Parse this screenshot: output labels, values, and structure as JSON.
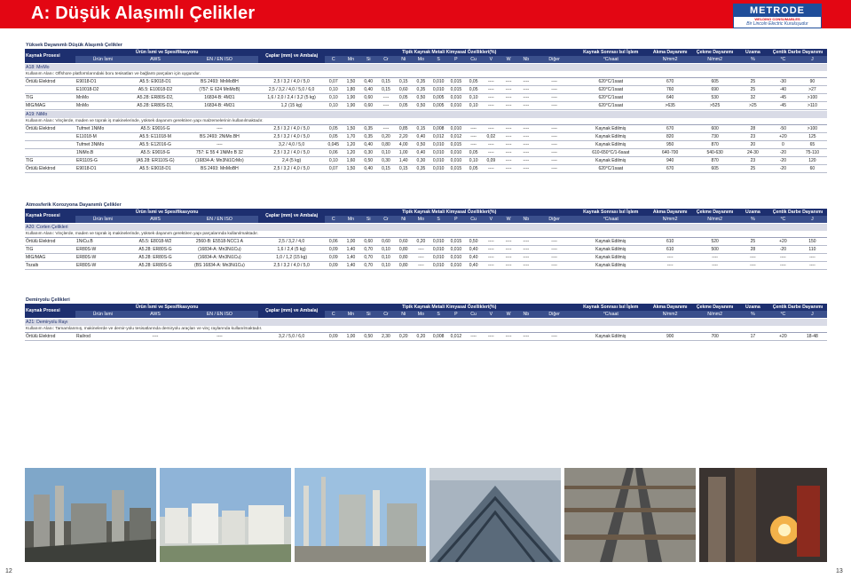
{
  "header": {
    "title": "A: Düşük Alaşımlı Çelikler",
    "logo_word": "METRODE",
    "logo_sub": "WELDING CONSUMABLES",
    "logo_tag": "Bir Lincoln Electric Kuruluşudur"
  },
  "colheads": {
    "process": "Kaynak Prosesi",
    "product_group": "Ürün İsmi  ve Spesifikasyonu",
    "product_name": "Ürün İsmi",
    "aws": "AWS",
    "en_iso": "EN / EN ISO",
    "diam": "Çaplar (mm) ve Ambalaj",
    "chem": "Tipik Kaynak Metali Kimyasal  Özellikleri(%)",
    "elements": [
      "C",
      "Mn",
      "Si",
      "Cr",
      "Ni",
      "Mo",
      "S",
      "P",
      "Cu",
      "V",
      "W",
      "Nb",
      "Diğer"
    ],
    "pwht": "Kaynak Sonrası Isıl İşlem",
    "pwht_unit": "°C/saat",
    "ys": "Akma Dayanımı",
    "ys_unit": "N/mm2",
    "ts": "Çekme Dayanımı",
    "ts_unit": "N/mm2",
    "el": "Uzama",
    "el_unit": "%",
    "imp": "Çentik Darbe Dayanımı",
    "imp_t_unit": "°C",
    "imp_j_unit": "J"
  },
  "sections": [
    {
      "title": "Yüksek Dayanımlı Düşük Alaşımlı Çelikler",
      "groups": [
        {
          "grade": "A18: MnMo",
          "usage": "Kullanım Alanı: Offshore platformlarındaki boru tesisatları ve bağlantı parçaları için uygundur.",
          "rows": [
            [
              "Örtülü Elektrod",
              "E9018-D1",
              "A5.5: E9018-D1",
              "BS 2493: MnMoBH",
              "2,5 / 3,2 / 4,0 / 5,0",
              "0,07",
              "1,50",
              "0,40",
              "0,15",
              "0,15",
              "0,35",
              "0,010",
              "0,015",
              "0,05",
              "----",
              "----",
              "----",
              "----",
              "620°C/1saat",
              "670",
              "605",
              "25",
              "-30",
              "90"
            ],
            [
              "",
              "E10018-D2",
              "A5.5: E10018-D2",
              "(757: E 624 MnMoB)",
              "2,5 / 3,2 / 4,0 / 5,0 / 6,0",
              "0,10",
              "1,80",
              "0,40",
              "0,15",
              "0,60",
              "0,35",
              "0,010",
              "0,015",
              "0,05",
              "----",
              "----",
              "----",
              "----",
              "620°C/1saat",
              "760",
              "690",
              "25",
              "-40",
              ">27"
            ],
            [
              "TIG",
              "MnMo",
              "A5.28: ER80S-D2,",
              "16834-B: 4M31",
              "1,6 / 2,0 / 2,4 / 3,2  (5 kg)",
              "0,10",
              "1,90",
              "0,60",
              "----",
              "0,05",
              "0,50",
              "0,005",
              "0,010",
              "0,10",
              "----",
              "----",
              "----",
              "----",
              "620°C/1saat",
              "640",
              "530",
              "32",
              "-45",
              ">100"
            ],
            [
              "MIG/MAG",
              "MnMo",
              "A5.28: ER80S-D2,",
              "16834-B: 4M31",
              "1,2 (15 kg)",
              "0,10",
              "1,90",
              "0,60",
              "----",
              "0,05",
              "0,50",
              "0,005",
              "0,010",
              "0,10",
              "----",
              "----",
              "----",
              "----",
              "620°C/1saat",
              ">635",
              ">525",
              ">25",
              "-45",
              ">110"
            ]
          ]
        },
        {
          "grade": "A19: NiMo",
          "usage": "Kullanım Alanı: Vinçlerde,  maden ve toprak iş makinelerinde, yüksek dayanım gerektiren yapı malzemelerinin kullanılmaktadır.",
          "rows": [
            [
              "Örtülü Elektrod",
              "Tufmet 1NiMo",
              "A5.5: E9016-G",
              "----",
              "2,5 / 3,2 / 4,0 / 5,0",
              "0,05",
              "1,50",
              "0,35",
              "----",
              "0,85",
              "0,15",
              "0,008",
              "0,010",
              "----",
              "----",
              "----",
              "----",
              "----",
              "Kaynak Edilmiş",
              "670",
              "600",
              "28",
              "-50",
              ">100"
            ],
            [
              "",
              "E11018-M",
              "A5.5: E11018-M",
              "BS 2493: 2NiMo.BH",
              "2,5 / 3,2 / 4,0 / 5,0",
              "0,05",
              "1,70",
              "0,35",
              "0,20",
              "2,20",
              "0,40",
              "0,012",
              "0,012",
              "----",
              "0,02",
              "----",
              "----",
              "----",
              "Kaynak Edilmiş",
              "820",
              "730",
              "23",
              "+20",
              "125"
            ],
            [
              "",
              "Tufmet 3NiMo",
              "A5.5: E12016-G",
              "----",
              "3,2 / 4,0 / 5,0",
              "0,045",
              "1,20",
              "0,40",
              "0,80",
              "4,00",
              "0,50",
              "0,010",
              "0,015",
              "----",
              "----",
              "----",
              "----",
              "----",
              "Kaynak Edilmiş",
              "950",
              "870",
              "20",
              "0",
              "65"
            ],
            [
              "",
              "1NiMo.B",
              "A5.5: E9018-G",
              "757: E 55 4 1NiMo B 32",
              "2,5 / 3,2 / 4,0 / 5,0",
              "0,06",
              "1,20",
              "0,30",
              "0,10",
              "1,00",
              "0,40",
              "0,010",
              "0,010",
              "0,05",
              "----",
              "----",
              "----",
              "----",
              "610-650°C/1-6saat",
              "640-700",
              "540-630",
              "24-30",
              "-20",
              "75-110"
            ],
            [
              "TIG",
              "ER110S-G",
              "(A5.28: ER110S-G)",
              "(16834-A: Mn3Ni1CrMo)",
              "2,4 (5 kg)",
              "0,10",
              "1,60",
              "0,50",
              "0,30",
              "1,40",
              "0,30",
              "0,010",
              "0,010",
              "0,10",
              "0,09",
              "----",
              "----",
              "----",
              "Kaynak Edilmiş",
              "940",
              "870",
              "23",
              "-20",
              "120"
            ],
            [
              "Örtülü Elektrod",
              "E9018-D1",
              "A5.5: E9018-D1",
              "BS 2493: MnMoBH",
              "2,5 / 3,2 / 4,0 / 5,0",
              "0,07",
              "1,50",
              "0,40",
              "0,15",
              "0,15",
              "0,35",
              "0,010",
              "0,015",
              "0,05",
              "----",
              "----",
              "----",
              "----",
              "620°C/1saat",
              "670",
              "605",
              "25",
              "-20",
              "60"
            ]
          ]
        }
      ]
    },
    {
      "title": "Atmosferik Korozyona Dayanımlı Çelikler",
      "groups": [
        {
          "grade": "A20: Corten Çelikleri",
          "usage": "Kullanım Alanı: Vinçlerde,  maden ve toprak iş makinelerinde, yüksek dayanım gerektiren yapı parçalarında kullanılmaktadır.",
          "rows": [
            [
              "Örtülü Elektrod",
              "1NiCu.B",
              "A5.5: E8018-W2",
              "2560-B: E5518-NCC1 A",
              "2,5 / 3,2 / 4,0",
              "0,06",
              "1,00",
              "0,60",
              "0,60",
              "0,60",
              "0,20",
              "0,010",
              "0,015",
              "0,50",
              "----",
              "----",
              "----",
              "----",
              "Kaynak Edilmiş",
              "610",
              "520",
              "25",
              "+20",
              "150"
            ],
            [
              "TIG",
              "ER80S-W",
              "A5.28: ER80S-G",
              "(16834-A: Mn3Ni1Cu)",
              "1,6 / 2,4 (5 kg)",
              "0,09",
              "1,40",
              "0,70",
              "0,10",
              "0,80",
              "----",
              "0,010",
              "0,010",
              "0,40",
              "----",
              "----",
              "----",
              "----",
              "Kaynak Edilmiş",
              "610",
              "500",
              "28",
              "-20",
              "110"
            ],
            [
              "MIG/MAG",
              "ER80S-W",
              "A5.28: ER80S-G",
              "(16834-A: Mn3Ni1Cu)",
              "1,0 / 1,2 (15 kg)",
              "0,09",
              "1,40",
              "0,70",
              "0,10",
              "0,80",
              "----",
              "0,010",
              "0,010",
              "0,40",
              "----",
              "----",
              "----",
              "----",
              "Kaynak Edilmiş",
              "----",
              "----",
              "----",
              "----",
              "----"
            ],
            [
              "Tozaltı",
              "ER80S-W",
              "A5.28: ER80S-G",
              "(BS 16834-A: Mn3Ni1Cu)",
              "2,5 / 3,2 / 4,0 / 5,0",
              "0,09",
              "1,40",
              "0,70",
              "0,10",
              "0,80",
              "----",
              "0,010",
              "0,010",
              "0,40",
              "----",
              "----",
              "----",
              "----",
              "Kaynak Edilmiş",
              "----",
              "----",
              "----",
              "----",
              "----"
            ]
          ]
        }
      ]
    },
    {
      "title": "Demiryolu Çelikleri",
      "groups": [
        {
          "grade": "A21: Demiryolu Rayı",
          "usage": "Kullanım Alanı:  Tamamlanmış, makinelerde ve demir-yolu tesisatlarında  demiryolu araçları ve vinç raylarında kullanılmaktadır.",
          "rows": [
            [
              "Örtülü Elektrod",
              "Railrod",
              "----",
              "----",
              "3,2 / 5,0 / 6,0",
              "0,09",
              "1,00",
              "0,50",
              "2,30",
              "0,20",
              "0,20",
              "0,008",
              "0,012",
              "----",
              "----",
              "----",
              "----",
              "----",
              "Kaynak Edilmiş",
              "900",
              "700",
              "17",
              "+20",
              "18-48"
            ]
          ]
        }
      ]
    }
  ],
  "photos": [
    {
      "name": "industrial-plant-photo"
    },
    {
      "name": "storage-tanks-photo"
    },
    {
      "name": "refinery-photo"
    },
    {
      "name": "steel-bridge-photo"
    },
    {
      "name": "railway-track-photo"
    },
    {
      "name": "welding-photo"
    }
  ],
  "pages": {
    "left": "12",
    "right": "13"
  }
}
